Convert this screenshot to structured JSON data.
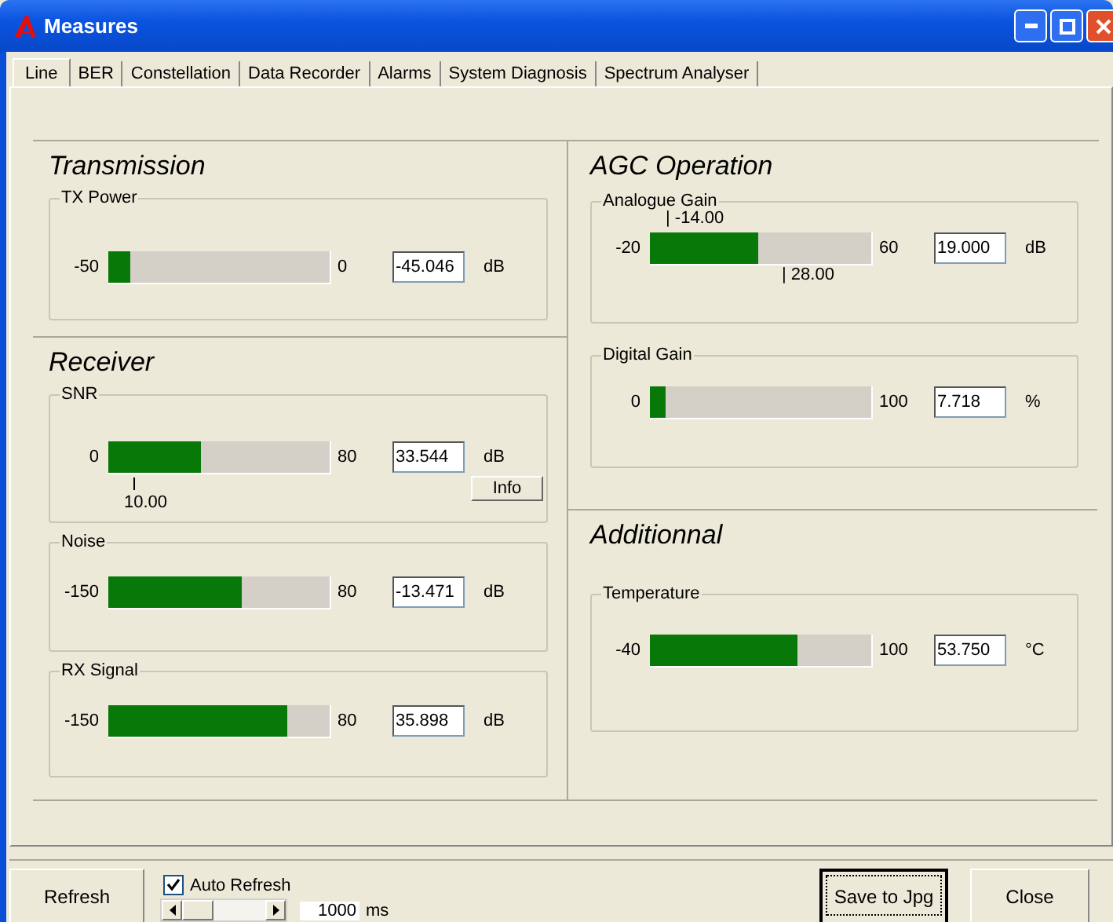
{
  "window": {
    "title": "Measures"
  },
  "tabs": [
    {
      "label": "Line",
      "selected": true
    },
    {
      "label": "BER",
      "selected": false
    },
    {
      "label": "Constellation",
      "selected": false
    },
    {
      "label": "Data Recorder",
      "selected": false
    },
    {
      "label": "Alarms",
      "selected": false
    },
    {
      "label": "System Diagnosis",
      "selected": false
    },
    {
      "label": "Spectrum Analyser",
      "selected": false
    }
  ],
  "columns": [
    {
      "sections": [
        {
          "title": "Transmission",
          "groups": [
            {
              "label": "TX Power",
              "min": "-50",
              "max": "0",
              "level": 0.1,
              "value": "-45.046",
              "unit": "dB"
            }
          ]
        },
        {
          "title": "Receiver",
          "groups": [
            {
              "label": "SNR",
              "min": "0",
              "max": "80",
              "level": 0.42,
              "value": "33.544",
              "unit": "dB",
              "markers_below": [
                {
                  "text": "10.00",
                  "kind": "stacked"
                }
              ],
              "button": "Info"
            },
            {
              "label": "Noise",
              "min": "-150",
              "max": "80",
              "level": 0.6,
              "value": "-13.471",
              "unit": "dB"
            },
            {
              "label": "RX Signal",
              "min": "-150",
              "max": "80",
              "level": 0.81,
              "value": "35.898",
              "unit": "dB"
            }
          ]
        }
      ]
    },
    {
      "sections": [
        {
          "title": "AGC Operation",
          "groups": [
            {
              "label": "Analogue Gain",
              "min": "-20",
              "max": "60",
              "level": 0.49,
              "value": "19.000",
              "unit": "dB",
              "markers_above": [
                {
                  "text": "| -14.00",
                  "kind": "inline"
                }
              ],
              "markers_below": [
                {
                  "text": "| 28.00",
                  "kind": "inline"
                }
              ]
            },
            {
              "label": "Digital Gain",
              "min": "0",
              "max": "100",
              "level": 0.07,
              "value": "7.718",
              "unit": "%"
            }
          ]
        },
        {
          "title": "Additionnal",
          "groups": [
            {
              "label": "Temperature",
              "min": "-40",
              "max": "100",
              "level": 0.67,
              "value": "53.750",
              "unit": "°C"
            }
          ]
        }
      ]
    }
  ],
  "footer": {
    "refresh": "Refresh",
    "auto_refresh": {
      "label": "Auto Refresh",
      "checked": true
    },
    "interval": {
      "value": "1000",
      "unit": "ms"
    },
    "save": "Save to Jpg",
    "close": "Close"
  }
}
